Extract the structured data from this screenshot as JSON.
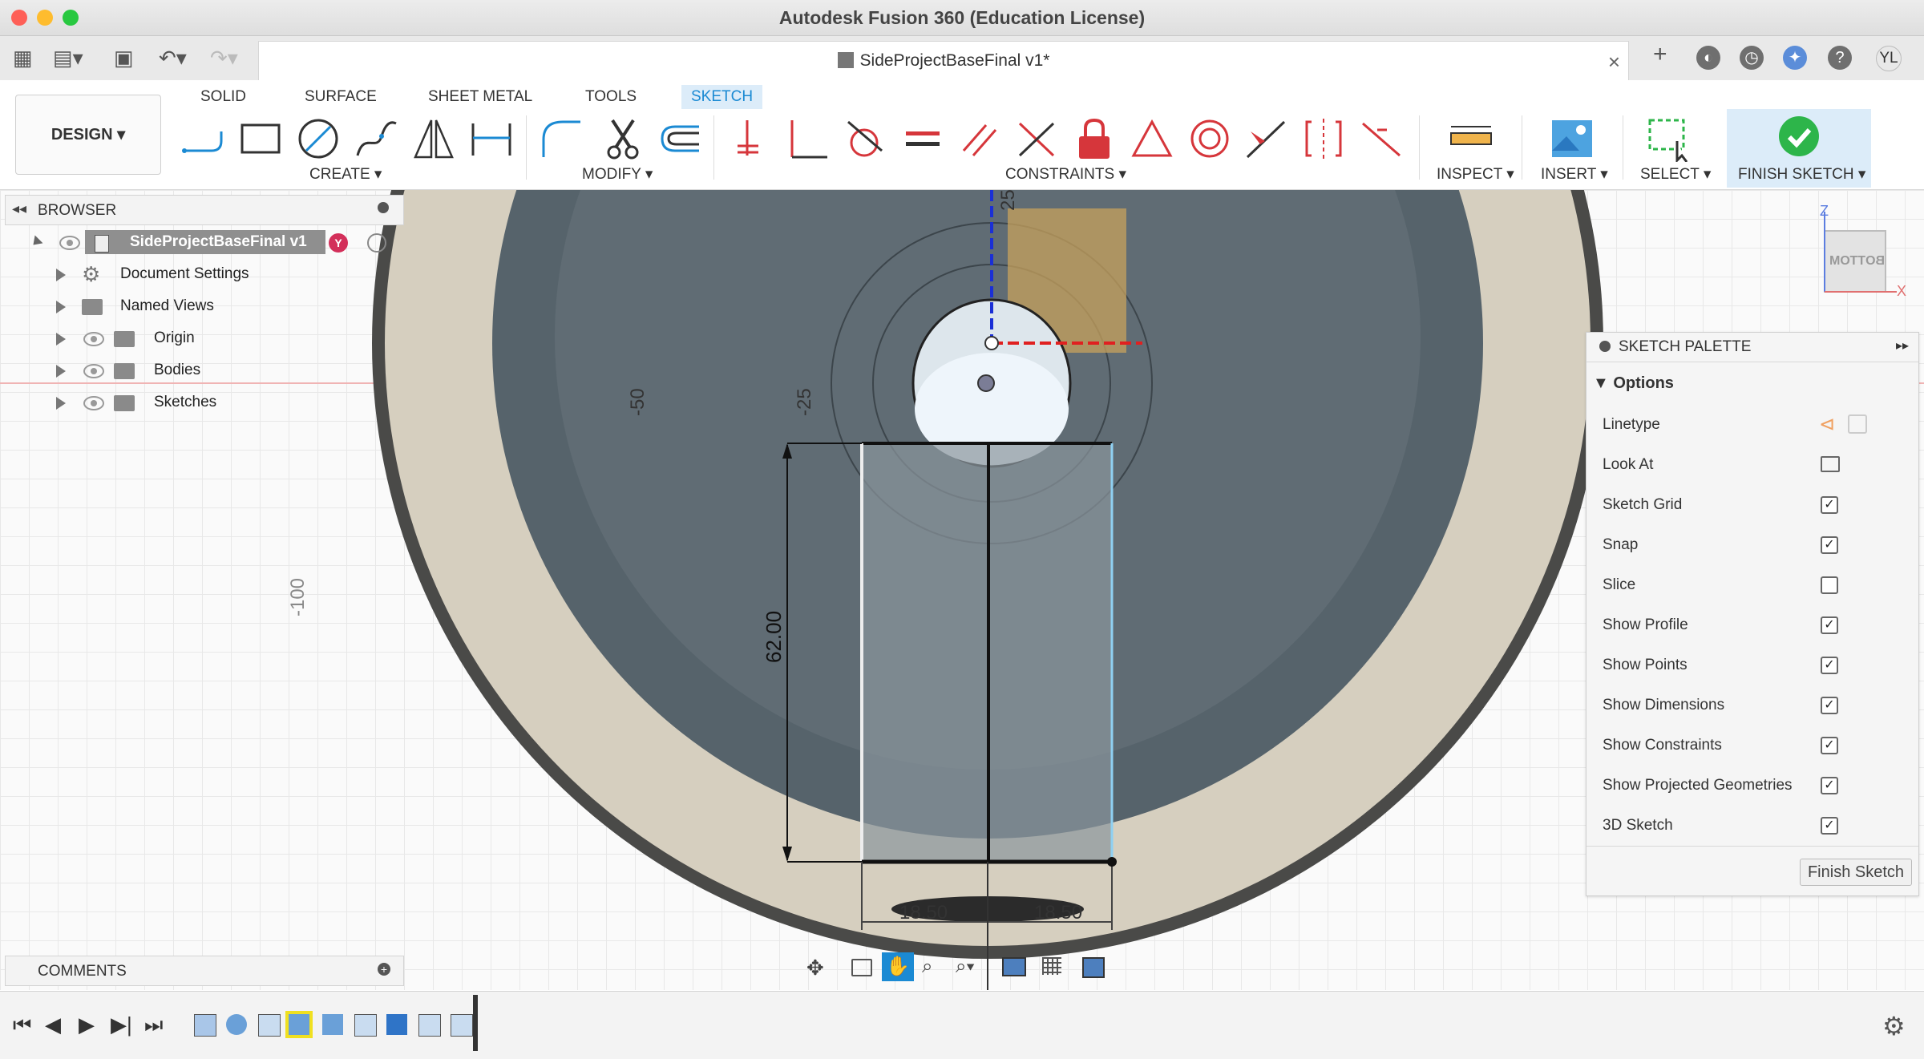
{
  "window": {
    "title": "Autodesk Fusion 360 (Education License)"
  },
  "doc_tab": {
    "label": "SideProjectBaseFinal v1*"
  },
  "account": {
    "initials": "YL"
  },
  "workspace": {
    "label": "DESIGN ▾"
  },
  "ribbon": {
    "tabs": [
      "SOLID",
      "SURFACE",
      "SHEET METAL",
      "TOOLS",
      "SKETCH"
    ],
    "active_tab": "SKETCH",
    "groups": {
      "create": "CREATE ▾",
      "modify": "MODIFY ▾",
      "constraints": "CONSTRAINTS ▾",
      "inspect": "INSPECT ▾",
      "insert": "INSERT ▾",
      "select": "SELECT ▾",
      "finish": "FINISH SKETCH ▾"
    }
  },
  "browser": {
    "title": "BROWSER",
    "root": "SideProjectBaseFinal v1",
    "items": [
      "Document Settings",
      "Named Views",
      "Origin",
      "Bodies",
      "Sketches"
    ]
  },
  "comments": {
    "title": "COMMENTS"
  },
  "canvas": {
    "axis_labels": [
      "-100",
      "-50",
      "-25",
      "25"
    ],
    "dimensions": [
      "62.00",
      "18.50",
      "18.50"
    ],
    "viewcube_face": "BOTTOM",
    "viewcube_axes": [
      "Z",
      "X"
    ]
  },
  "sketch_palette": {
    "title": "SKETCH PALETTE",
    "section": "Options",
    "rows": [
      {
        "label": "Linetype",
        "type": "icons"
      },
      {
        "label": "Look At",
        "type": "icon"
      },
      {
        "label": "Sketch Grid",
        "checked": true
      },
      {
        "label": "Snap",
        "checked": true
      },
      {
        "label": "Slice",
        "checked": false
      },
      {
        "label": "Show Profile",
        "checked": true
      },
      {
        "label": "Show Points",
        "checked": true
      },
      {
        "label": "Show Dimensions",
        "checked": true
      },
      {
        "label": "Show Constraints",
        "checked": true
      },
      {
        "label": "Show Projected Geometries",
        "checked": true
      },
      {
        "label": "3D Sketch",
        "checked": true
      }
    ],
    "finish_button": "Finish Sketch"
  },
  "colors": {
    "accent": "#1b8ad3",
    "finish_green": "#2db54a",
    "constraint_red": "#d6363b",
    "badge": "#d32f5a"
  }
}
